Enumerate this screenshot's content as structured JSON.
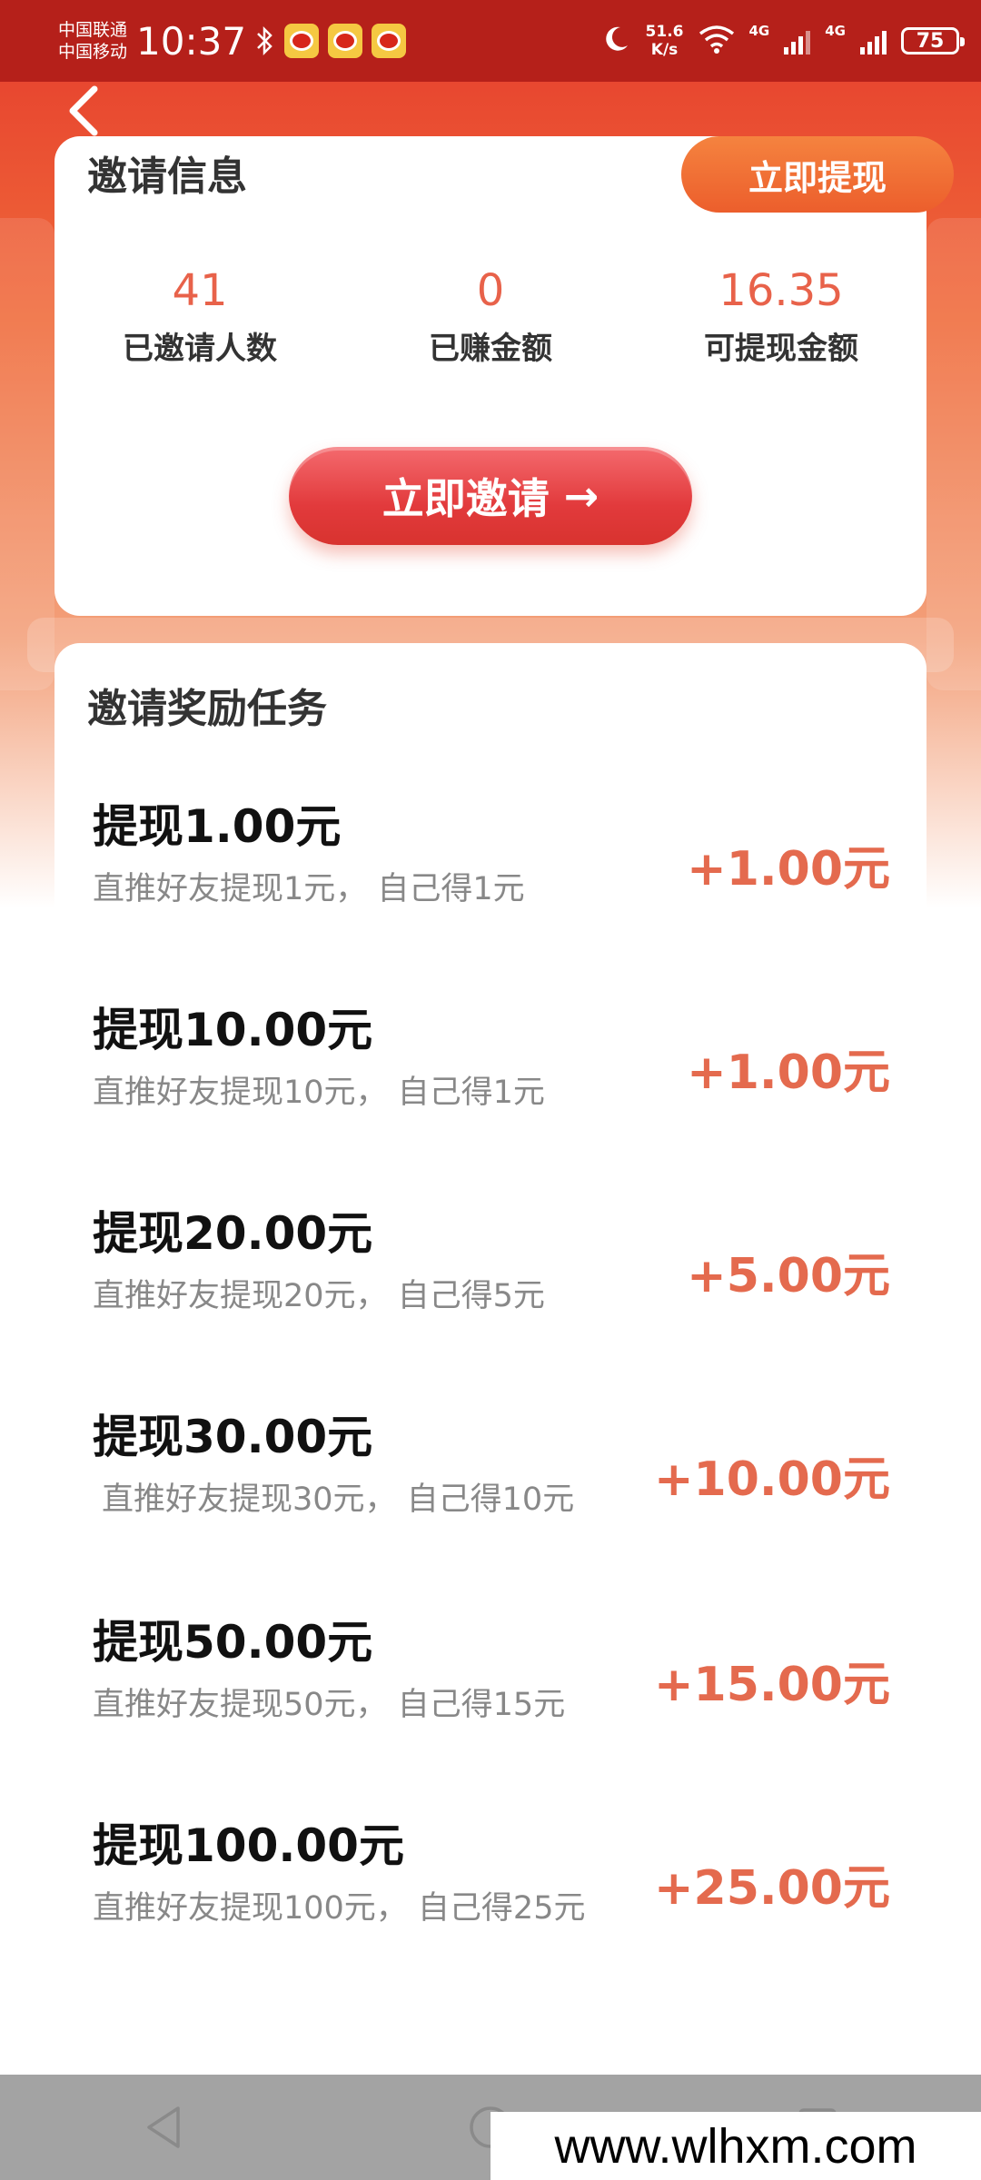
{
  "status_bar": {
    "carrier_1": "中国联通",
    "carrier_2": "中国移动",
    "time": "10:37",
    "net_speed_value": "51.6",
    "net_speed_unit": "K/s",
    "net_type_1": "4G",
    "net_type_2": "4G",
    "battery": "75",
    "icons": [
      "bluetooth-icon",
      "weibo-icon",
      "weibo-icon",
      "weibo-icon",
      "moon-icon",
      "wifi-icon",
      "signal-icon",
      "signal-icon",
      "battery-icon"
    ]
  },
  "info_card": {
    "title": "邀请信息",
    "withdraw_button": "立即提现",
    "stats": [
      {
        "value": "41",
        "label": "已邀请人数"
      },
      {
        "value": "0",
        "label": "已赚金额"
      },
      {
        "value": "16.35",
        "label": "可提现金额"
      }
    ],
    "invite_button": "立即邀请",
    "invite_arrow": "→"
  },
  "tasks_card": {
    "title": "邀请奖励任务",
    "tasks": [
      {
        "title": "提现1.00元",
        "desc": "直推好友提现1元， 自己得1元",
        "reward": "+1.00元"
      },
      {
        "title": "提现10.00元",
        "desc": "直推好友提现10元， 自己得1元",
        "reward": "+1.00元"
      },
      {
        "title": "提现20.00元",
        "desc": "直推好友提现20元， 自己得5元",
        "reward": "+5.00元"
      },
      {
        "title": "提现30.00元",
        "desc": "直推好友提现30元， 自己得10元",
        "reward": "+10.00元"
      },
      {
        "title": "提现50.00元",
        "desc": "直推好友提现50元， 自己得15元",
        "reward": "+15.00元"
      },
      {
        "title": "提现100.00元",
        "desc": "直推好友提现100元， 自己得25元",
        "reward": "+25.00元"
      }
    ]
  },
  "watermark": "www.wlhxm.com",
  "colors": {
    "header_red": "#b5201a",
    "accent_orange": "#ec5e2c",
    "reward_red": "#e46a4e",
    "stat_red": "#e8624a"
  }
}
